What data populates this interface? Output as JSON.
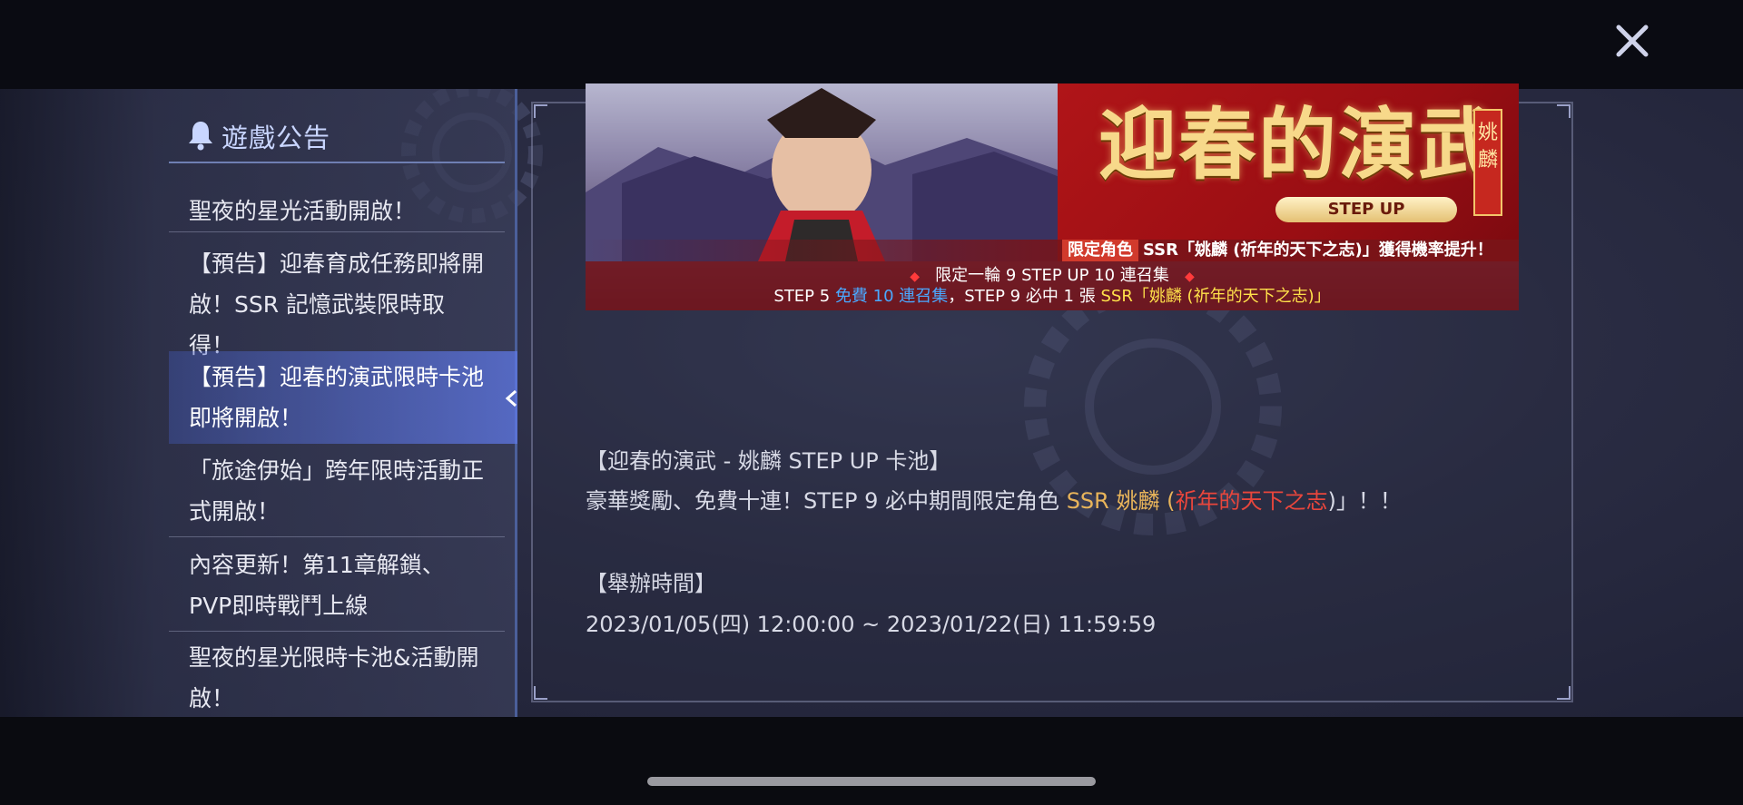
{
  "close_button": {
    "icon": "close-icon"
  },
  "sidebar": {
    "title": "遊戲公告",
    "icon": "bell-icon",
    "items": [
      {
        "label": "聖夜的星光活動開啟！",
        "active": false
      },
      {
        "label": "【預告】迎春育成任務即將開啟！SSR 記憶武裝限時取得！",
        "active": false
      },
      {
        "label": "【預告】迎春的演武限時卡池即將開啟！",
        "active": true
      },
      {
        "label": "「旅途伊始」跨年限時活動正式開啟！",
        "active": false
      },
      {
        "label": "內容更新！第11章解鎖、PVP即時戰鬥上線",
        "active": false
      },
      {
        "label": "聖夜的星光限時卡池&活動開啟！",
        "active": false
      }
    ]
  },
  "banner": {
    "title": "迎春的演武",
    "subtitle": "STEP UP",
    "character": "姚麟",
    "tag": "限定角色",
    "rate_text": "SSR「姚麟 (祈年的天下之志)」獲得機率提升！",
    "line1": "限定一輪 9 STEP UP 10 連召集",
    "line2_a": "STEP 5 ",
    "line2_b": "免費 10 連召集",
    "line2_c": "，STEP 9 必中 1 張 ",
    "line2_d": "SSR「姚麟 (祈年的天下之志)」"
  },
  "content": {
    "heading": "【迎春的演武 - 姚麟 STEP UP 卡池】",
    "desc_a": "豪華獎勵、免費十連！STEP  9 必中期間限定角色 ",
    "desc_b": "SSR 姚麟",
    "desc_c": " (",
    "desc_d": "祈年的天下之志",
    "desc_e": ")」！！",
    "time_heading": "【舉辦時間】",
    "time_value": "2023/01/05(四) 12:00:00 ~ 2023/01/22(日) 11:59:59"
  },
  "colors": {
    "accent_blue": "#4aa8ff",
    "highlight_gold": "#e8b45a",
    "highlight_red": "#e8463c",
    "banner_red": "#b01518"
  }
}
